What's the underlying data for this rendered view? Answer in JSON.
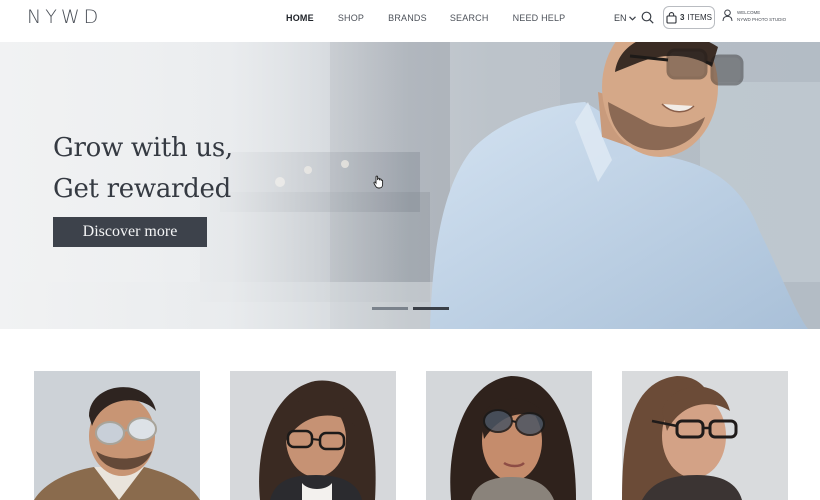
{
  "brand": {
    "logo": "NYWD"
  },
  "nav": {
    "items": [
      {
        "label": "HOME",
        "active": true
      },
      {
        "label": "SHOP"
      },
      {
        "label": "BRANDS"
      },
      {
        "label": "SEARCH"
      },
      {
        "label": "NEED HELP"
      }
    ]
  },
  "header": {
    "language": "EN",
    "cart": {
      "count": "3",
      "label": "ITEMS"
    },
    "user": {
      "line1": "WELCOME",
      "line2": "NYWD PHOTO STUDIO"
    }
  },
  "hero": {
    "headline_line1": "Grow with us,",
    "headline_line2": "Get rewarded",
    "cta_label": "Discover more",
    "slides": 2,
    "active_slide": 2
  },
  "icons": [
    "search-icon",
    "bag-icon",
    "user-icon",
    "chevron-down-icon",
    "cursor-icon"
  ],
  "colors": {
    "cta": "#3d424b",
    "text": "#353a42"
  }
}
